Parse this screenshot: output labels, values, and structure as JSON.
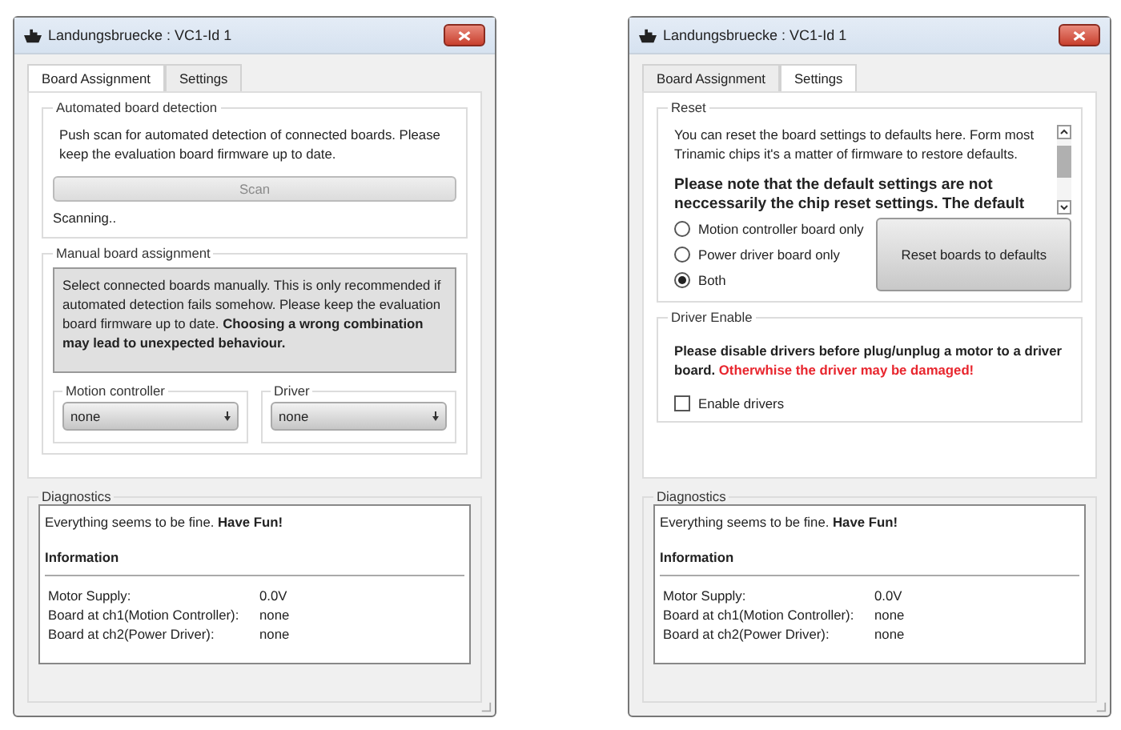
{
  "windows": [
    {
      "title": "Landungsbruecke : VC1-Id 1",
      "tabs": [
        {
          "label": "Board Assignment",
          "selected": true
        },
        {
          "label": "Settings",
          "selected": false
        }
      ],
      "page": {
        "kind": "board_assignment",
        "detection": {
          "title": "Automated board detection",
          "text": "Push scan for automated detection of connected boards. Please keep the evaluation board firmware up to date.",
          "scan_button": {
            "label": "Scan",
            "disabled": true
          },
          "status": "Scanning.."
        },
        "manual": {
          "title": "Manual board assignment",
          "note": "Select connected boards manually. This is only recommended if automated detection fails somehow. Please keep the evaluation board firmware up to date. **Choosing a wrong combination may lead to unexpected behaviour.**",
          "selectors": [
            {
              "title": "Motion controller",
              "value": "none"
            },
            {
              "title": "Driver",
              "value": "none"
            }
          ]
        }
      },
      "diagnostics": {
        "title": "Diagnostics",
        "message": "Everything seems to be fine. **Have Fun!**",
        "heading": "Information",
        "rows": [
          {
            "label": "Motor Supply:",
            "value": "0.0V"
          },
          {
            "label": "Board at ch1(Motion Controller):",
            "value": "none"
          },
          {
            "label": "Board at ch2(Power Driver):",
            "value": "none"
          }
        ]
      }
    },
    {
      "title": "Landungsbruecke : VC1-Id 1",
      "tabs": [
        {
          "label": "Board Assignment",
          "selected": false
        },
        {
          "label": "Settings",
          "selected": true
        }
      ],
      "page": {
        "kind": "settings",
        "reset": {
          "title": "Reset",
          "info": "You can reset the board settings to defaults here. Form most Trinamic chips it's a matter of firmware to restore defaults.",
          "note": "Please note that the default settings are not neccessarily the chip reset settings. The default",
          "options": [
            {
              "label": "Motion controller board only",
              "selected": false
            },
            {
              "label": "Power driver board only",
              "selected": false
            },
            {
              "label": "Both",
              "selected": true
            }
          ],
          "button": "Reset boards to defaults"
        },
        "driver_enable": {
          "title": "Driver Enable",
          "warning": "Please disable drivers before plug/unplug a motor to a driver board.",
          "danger": "Otherwhise the driver may be damaged!",
          "checkbox": {
            "label": "Enable drivers",
            "checked": false
          }
        }
      },
      "diagnostics": {
        "title": "Diagnostics",
        "message": "Everything seems to be fine. **Have Fun!**",
        "heading": "Information",
        "rows": [
          {
            "label": "Motor Supply:",
            "value": "0.0V"
          },
          {
            "label": "Board at ch1(Motion Controller):",
            "value": "none"
          },
          {
            "label": "Board at ch2(Power Driver):",
            "value": "none"
          }
        ]
      }
    }
  ]
}
